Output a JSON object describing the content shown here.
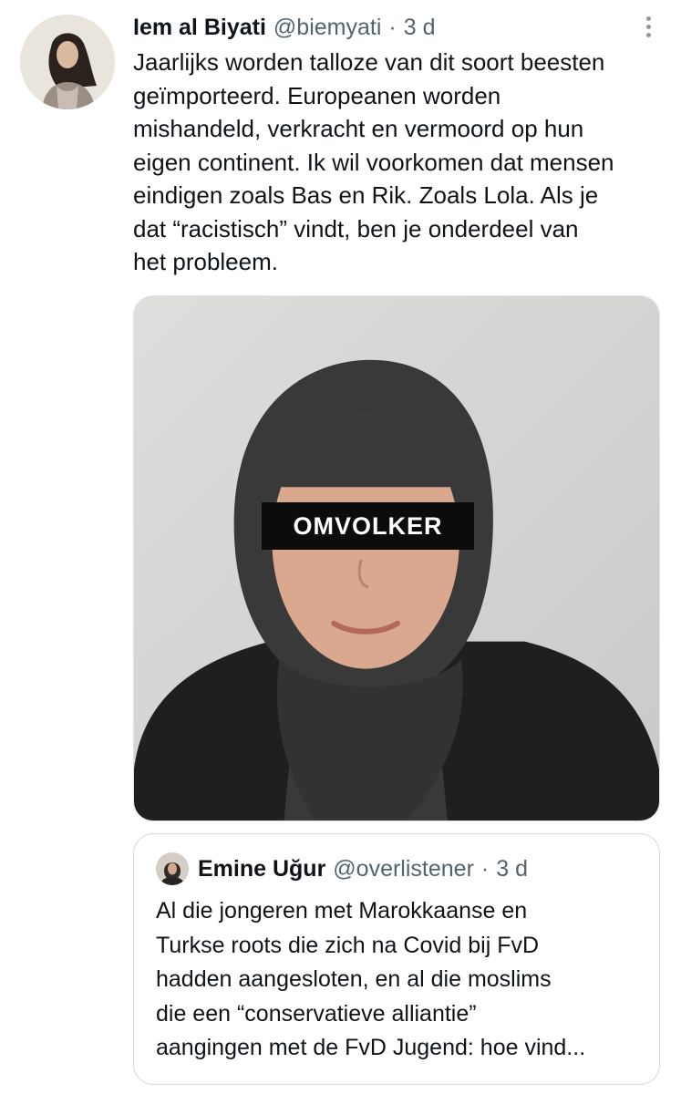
{
  "tweet": {
    "author_name": "Iem al Biyati",
    "author_handle": "@biemyati",
    "separator": "·",
    "time": "3 d",
    "avatar_icon": "profile-photo",
    "more_icon": "more-options-icon",
    "text": "Jaarlijks worden talloze van dit soort beesten\ngeïmporteerd. Europeanen worden\nmishandeld, verkracht en vermoord op hun\neigen continent. Ik wil voorkomen dat mensen\neindigen zoals Bas en Rik. Zoals Lola. Als je\ndat “racistisch” vindt, ben je onderdeel van\nhet probleem.",
    "media": {
      "censor_label": "OMVOLKER"
    }
  },
  "quoted_tweet": {
    "author_name": "Emine Uğur",
    "author_handle": "@overlistener",
    "separator": "·",
    "time": "3 d",
    "text": "Al die jongeren met Marokkaanse en\nTurkse roots die zich na Covid bij FvD\nhadden aangesloten, en al die moslims\ndie een “conservatieve alliantie”\naangingen met de FvD Jugend: hoe vind..."
  },
  "colors": {
    "text_primary": "#0f1419",
    "text_secondary": "#536471",
    "border": "#cfd9de"
  }
}
